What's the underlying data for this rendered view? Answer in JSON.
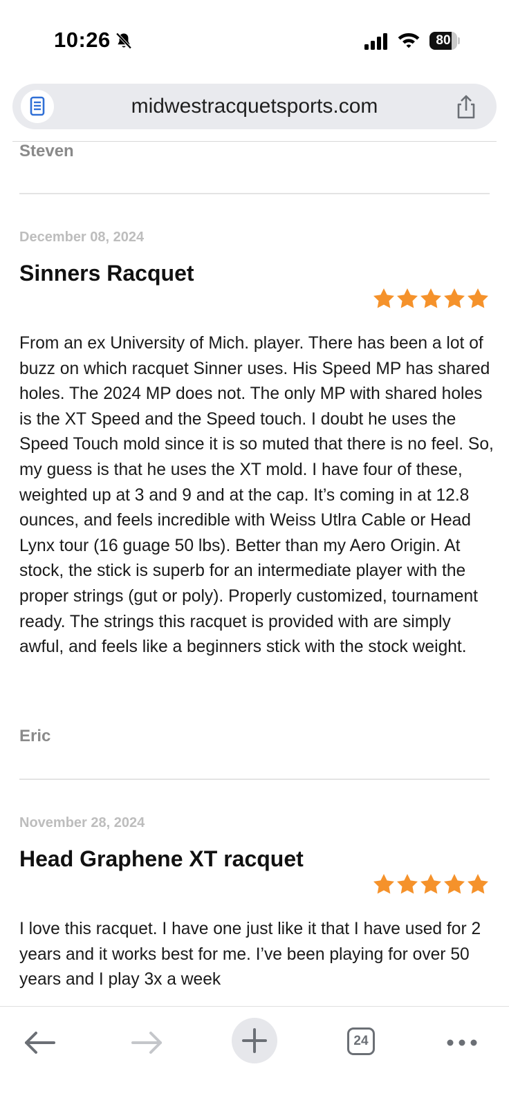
{
  "status_bar": {
    "time": "10:26",
    "battery": "80",
    "battery_level": 0.8
  },
  "browser": {
    "url": "midwestracquetsports.com",
    "tabs_count": "24"
  },
  "reviews": [
    {
      "author": "Steven"
    },
    {
      "date": "December 08, 2024",
      "title": "Sinners Racquet",
      "rating": 5,
      "body": "From an ex University of Mich. player. There has been a lot of buzz on which racquet Sinner uses. His Speed MP has shared holes. The 2024 MP does not. The only MP with shared holes is the XT Speed and the Speed touch. I doubt he uses the Speed Touch mold since it is so muted that there is no feel. So, my guess is that he uses the XT mold. I have four of these, weighted up at 3 and 9 and at the cap. It’s coming in at 12.8 ounces, and feels incredible with Weiss Utlra Cable or Head Lynx tour (16 guage 50 lbs). Better than my Aero Origin. At stock, the stick is superb for an intermediate player with the proper strings (gut or poly). Properly customized, tournament ready. The strings this racquet is provided with are simply awful, and feels like a beginners stick with the stock weight.",
      "author": "Eric"
    },
    {
      "date": "November 28, 2024",
      "title": "Head Graphene XT racquet",
      "rating": 5,
      "body": "I love this racquet. I have one just like it that I have used for 2 years and it works best for me. I’ve been playing for over 50 years and I play 3x a week"
    }
  ],
  "colors": {
    "star": "#f5922b",
    "accent_blue": "#2f6fd6"
  }
}
